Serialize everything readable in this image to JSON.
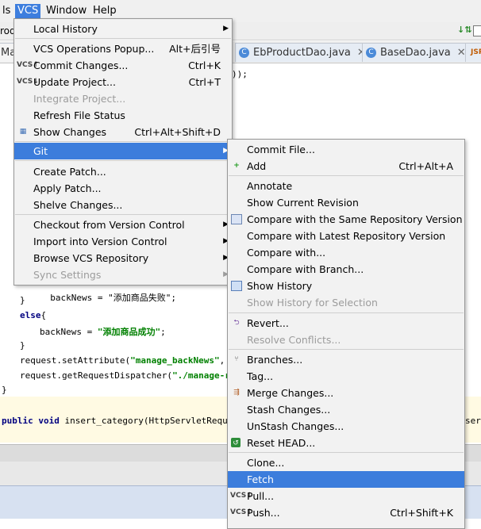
{
  "menubar": {
    "items": [
      {
        "label": "ls"
      },
      {
        "label": "VCS"
      },
      {
        "label": "Window"
      },
      {
        "label": "Help"
      }
    ]
  },
  "toolbar": {
    "left_text": "rod"
  },
  "tabs": [
    {
      "label": "Mai"
    },
    {
      "label": "EbProductDao.java"
    },
    {
      "label": "BaseDao.java"
    },
    {
      "label": "JSP"
    }
  ],
  "code": {
    "line1": "));",
    "line2": "backNews = \"添加商品失败\";",
    "line3": "}",
    "line4_kw": "else",
    "line4_rest": "{",
    "line5_a": "backNews = ",
    "line5_str": "\"添加商品成功\"",
    "line5_b": ";",
    "line6": "}",
    "line7_a": "request.setAttribute(",
    "line7_str": "\"manage_backNews\"",
    "line7_b": ", b",
    "line8_a": "request.getRequestDispatcher(",
    "line8_str": "\"./manage-res",
    "line9": "}",
    "line10_kw1": "public",
    "line10_kw2": "void",
    "line10_rest": "insert_category(HttpServletRequest",
    "line10_tail": "servl"
  },
  "vcs_menu": {
    "items": [
      {
        "label": "Local History",
        "shortcut": "",
        "submenu": true,
        "disabled": false
      },
      {
        "label": "VCS Operations Popup...",
        "shortcut": "Alt+后引号",
        "submenu": false,
        "disabled": false
      },
      {
        "label": "Commit Changes...",
        "shortcut": "Ctrl+K",
        "submenu": false,
        "disabled": false,
        "icon": "vcs-commit-icon"
      },
      {
        "label": "Update Project...",
        "shortcut": "Ctrl+T",
        "submenu": false,
        "disabled": false,
        "icon": "vcs-update-icon"
      },
      {
        "label": "Integrate Project...",
        "shortcut": "",
        "submenu": false,
        "disabled": true
      },
      {
        "label": "Refresh File Status",
        "shortcut": "",
        "submenu": false,
        "disabled": false
      },
      {
        "label": "Show Changes",
        "shortcut": "Ctrl+Alt+Shift+D",
        "submenu": false,
        "disabled": false,
        "icon": "changes-icon"
      },
      {
        "label": "Git",
        "shortcut": "",
        "submenu": true,
        "disabled": false,
        "selected": true
      },
      {
        "label": "Create Patch...",
        "shortcut": "",
        "submenu": false,
        "disabled": false
      },
      {
        "label": "Apply Patch...",
        "shortcut": "",
        "submenu": false,
        "disabled": false
      },
      {
        "label": "Shelve Changes...",
        "shortcut": "",
        "submenu": false,
        "disabled": false
      },
      {
        "label": "Checkout from Version Control",
        "shortcut": "",
        "submenu": true,
        "disabled": false
      },
      {
        "label": "Import into Version Control",
        "shortcut": "",
        "submenu": true,
        "disabled": false
      },
      {
        "label": "Browse VCS Repository",
        "shortcut": "",
        "submenu": true,
        "disabled": false
      },
      {
        "label": "Sync Settings",
        "shortcut": "",
        "submenu": true,
        "disabled": true
      }
    ]
  },
  "git_menu": {
    "items": [
      {
        "label": "Commit File...",
        "shortcut": ""
      },
      {
        "label": "Add",
        "shortcut": "Ctrl+Alt+A"
      },
      {
        "label": "Annotate",
        "shortcut": ""
      },
      {
        "label": "Show Current Revision",
        "shortcut": ""
      },
      {
        "label": "Compare with the Same Repository Version",
        "shortcut": ""
      },
      {
        "label": "Compare with Latest Repository Version",
        "shortcut": ""
      },
      {
        "label": "Compare with...",
        "shortcut": ""
      },
      {
        "label": "Compare with Branch...",
        "shortcut": ""
      },
      {
        "label": "Show History",
        "shortcut": ""
      },
      {
        "label": "Show History for Selection",
        "shortcut": ""
      },
      {
        "label": "Revert...",
        "shortcut": ""
      },
      {
        "label": "Resolve Conflicts...",
        "shortcut": ""
      },
      {
        "label": "Branches...",
        "shortcut": ""
      },
      {
        "label": "Tag...",
        "shortcut": ""
      },
      {
        "label": "Merge Changes...",
        "shortcut": ""
      },
      {
        "label": "Stash Changes...",
        "shortcut": ""
      },
      {
        "label": "UnStash Changes...",
        "shortcut": ""
      },
      {
        "label": "Reset HEAD...",
        "shortcut": ""
      },
      {
        "label": "Clone...",
        "shortcut": ""
      },
      {
        "label": "Fetch",
        "shortcut": ""
      },
      {
        "label": "Pull...",
        "shortcut": ""
      },
      {
        "label": "Push...",
        "shortcut": "Ctrl+Shift+K"
      }
    ]
  },
  "colors": {
    "selection": "#3c7ddc",
    "menu_bg": "#f2f2f2",
    "disabled_text": "#9c9c9c"
  }
}
